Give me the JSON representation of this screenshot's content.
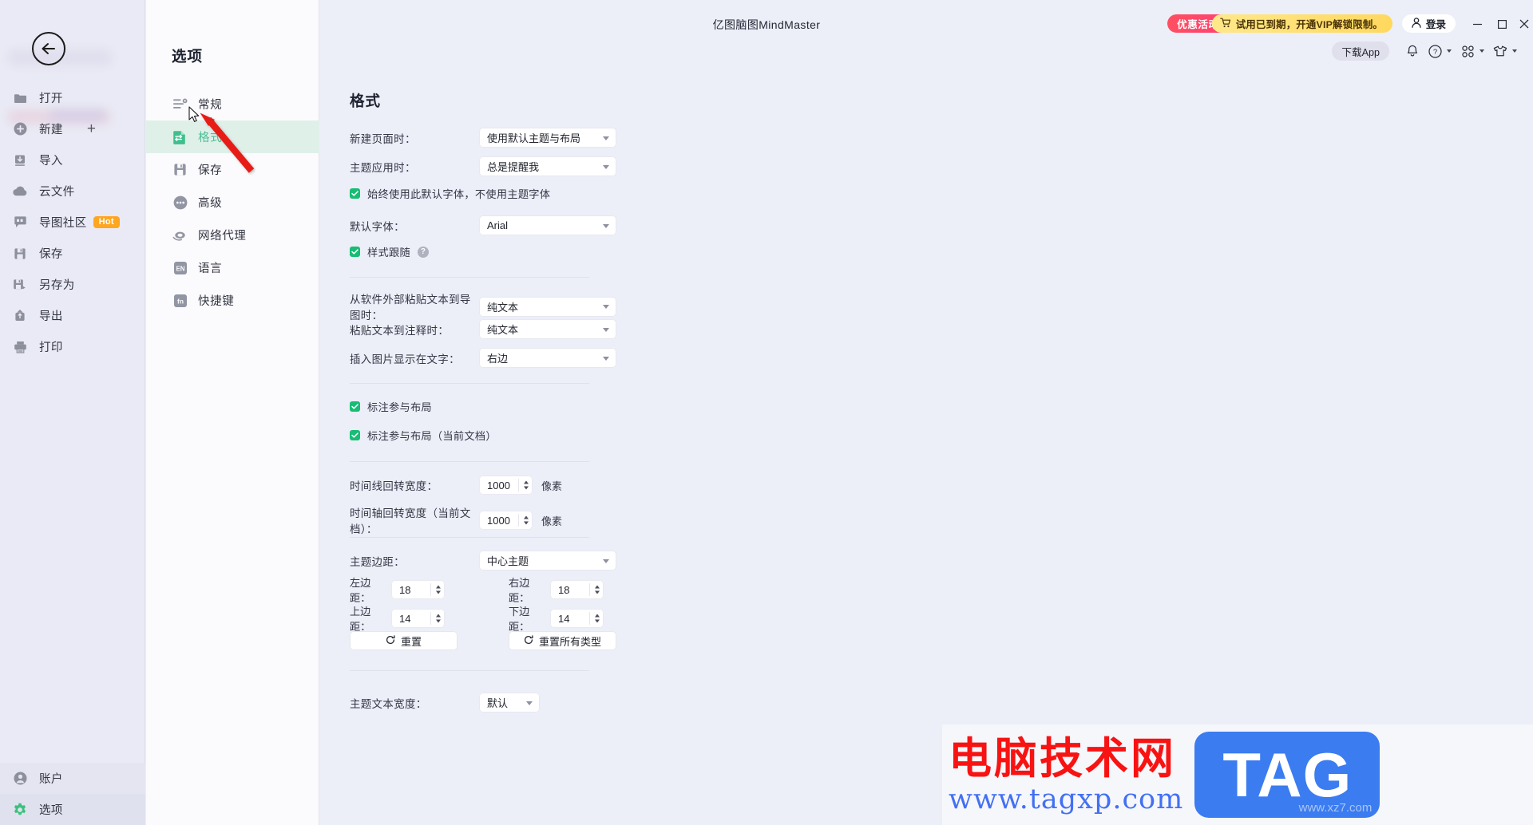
{
  "window": {
    "app_title": "亿图脑图MindMaster",
    "minimize": "minimize-button",
    "maximize": "maximize-button",
    "close": "close-button"
  },
  "header": {
    "promo_label": "优惠活动",
    "vip_banner": "试用已到期，开通VIP解锁限制。",
    "login_label": "登录",
    "download_app": "下载App",
    "accent_promo": "#ff4f62",
    "accent_vip": "#ffd85e"
  },
  "sidebar": {
    "back": "back-button",
    "items": [
      {
        "label": "打开",
        "icon": "folder-icon"
      },
      {
        "label": "新建",
        "icon": "plus-circle-icon",
        "extra": "+"
      },
      {
        "label": "导入",
        "icon": "import-icon"
      },
      {
        "label": "云文件",
        "icon": "cloud-icon"
      },
      {
        "label": "导图社区",
        "icon": "community-icon",
        "badge": "Hot"
      },
      {
        "label": "保存",
        "icon": "save-icon"
      },
      {
        "label": "另存为",
        "icon": "save-as-icon"
      },
      {
        "label": "导出",
        "icon": "export-icon"
      },
      {
        "label": "打印",
        "icon": "print-icon"
      }
    ],
    "bottom_items": [
      {
        "label": "账户",
        "icon": "account-icon"
      },
      {
        "label": "选项",
        "icon": "gear-icon"
      }
    ]
  },
  "options_panel": {
    "title": "选项",
    "items": [
      {
        "label": "常规",
        "icon": "general-icon",
        "active": false
      },
      {
        "label": "格式",
        "icon": "format-icon",
        "active": true
      },
      {
        "label": "保存",
        "icon": "save-icon",
        "active": false
      },
      {
        "label": "高级",
        "icon": "advanced-dots-icon",
        "active": false
      },
      {
        "label": "网络代理",
        "icon": "network-proxy-icon",
        "active": false
      },
      {
        "label": "语言",
        "icon": "language-en-icon",
        "active": false
      },
      {
        "label": "快捷键",
        "icon": "fn-key-icon",
        "active": false
      }
    ],
    "active_bg": "#dff0e9",
    "active_text": "#4cbd96"
  },
  "format": {
    "heading": "格式",
    "new_page_label": "新建页面时：",
    "new_page_value": "使用默认主题与布局",
    "theme_apply_label": "主题应用时：",
    "theme_apply_value": "总是提醒我",
    "always_default_font_label": "始终使用此默认字体，不使用主题字体",
    "always_default_font_checked": true,
    "default_font_label": "默认字体：",
    "default_font_value": "Arial",
    "style_follow_label": "样式跟随",
    "style_follow_checked": true,
    "help_glyph": "?",
    "paste_external_label": "从软件外部粘贴文本到导图时：",
    "paste_external_value": "纯文本",
    "paste_note_label": "粘贴文本到注释时：",
    "paste_note_value": "纯文本",
    "image_position_label": "插入图片显示在文字：",
    "image_position_value": "右边",
    "callout_layout_label": "标注参与布局",
    "callout_layout_checked": true,
    "callout_layout_doc_label": "标注参与布局（当前文档）",
    "callout_layout_doc_checked": true,
    "timeline_width_label": "时间线回转宽度：",
    "timeline_width_value": "1000",
    "timeline_width_unit": "像素",
    "timeaxis_width_label": "时间轴回转宽度（当前文档）：",
    "timeaxis_width_value": "1000",
    "timeaxis_width_unit": "像素",
    "topic_margin_label": "主题边距：",
    "topic_margin_value": "中心主题",
    "margin_left_label": "左边距：",
    "margin_left_value": "18",
    "margin_right_label": "右边距：",
    "margin_right_value": "18",
    "margin_top_label": "上边距：",
    "margin_top_value": "14",
    "margin_bottom_label": "下边距：",
    "margin_bottom_value": "14",
    "reset_label": "重置",
    "reset_all_label": "重置所有类型",
    "topic_text_width_label": "主题文本宽度：",
    "topic_text_width_value": "默认"
  },
  "watermark": {
    "cn_text": "电脑技术网",
    "url_text": "www.tagxp.com",
    "tag_text": "TAG",
    "sub_text": "www.xz7.com",
    "red": "#f81313",
    "blue": "#4370f3"
  }
}
